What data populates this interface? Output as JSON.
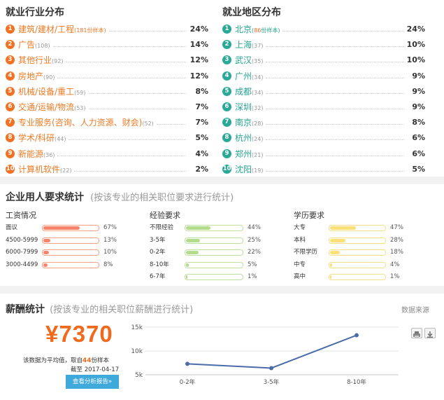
{
  "industry": {
    "title": "就业行业分布",
    "items": [
      {
        "rank": "1",
        "name": "建筑/建材/工程",
        "count_num": "181",
        "count_suffix": "份样本",
        "highlight": true,
        "pct": "24%"
      },
      {
        "rank": "2",
        "name": "广告",
        "count": "(108)",
        "pct": "14%"
      },
      {
        "rank": "3",
        "name": "其他行业",
        "count": "(92)",
        "pct": "12%"
      },
      {
        "rank": "4",
        "name": "房地产",
        "count": "(90)",
        "pct": "12%"
      },
      {
        "rank": "5",
        "name": "机械/设备/重工",
        "count": "(59)",
        "pct": "8%"
      },
      {
        "rank": "6",
        "name": "交通/运输/物流",
        "count": "(53)",
        "pct": "7%"
      },
      {
        "rank": "7",
        "name": "专业服务(咨询、人力资源、财会)",
        "count": "(52)",
        "pct": "7%"
      },
      {
        "rank": "8",
        "name": "学术/科研",
        "count": "(44)",
        "pct": "5%"
      },
      {
        "rank": "9",
        "name": "新能源",
        "count": "(36)",
        "pct": "4%"
      },
      {
        "rank": "10",
        "name": "计算机软件",
        "count": "(22)",
        "pct": "2%"
      }
    ]
  },
  "region": {
    "title": "就业地区分布",
    "items": [
      {
        "rank": "1",
        "name": "北京",
        "count_num": "86",
        "count_suffix": "份样本",
        "highlight": true,
        "pct": "24%"
      },
      {
        "rank": "2",
        "name": "上海",
        "count": "(37)",
        "pct": "10%"
      },
      {
        "rank": "3",
        "name": "武汉",
        "count": "(35)",
        "pct": "10%"
      },
      {
        "rank": "4",
        "name": "广州",
        "count": "(34)",
        "pct": "9%"
      },
      {
        "rank": "5",
        "name": "成都",
        "count": "(34)",
        "pct": "9%"
      },
      {
        "rank": "6",
        "name": "深圳",
        "count": "(32)",
        "pct": "9%"
      },
      {
        "rank": "7",
        "name": "南京",
        "count": "(28)",
        "pct": "8%"
      },
      {
        "rank": "8",
        "name": "杭州",
        "count": "(24)",
        "pct": "6%"
      },
      {
        "rank": "9",
        "name": "郑州",
        "count": "(21)",
        "pct": "6%"
      },
      {
        "rank": "10",
        "name": "沈阳",
        "count": "(19)",
        "pct": "5%"
      }
    ]
  },
  "requirements": {
    "title": "企业用人要求统计",
    "note": "(按该专业的相关职位要求进行统计)",
    "groups": [
      {
        "title": "工资情况",
        "track_color": "#f5a089",
        "fill_color": "#f7846a",
        "items": [
          {
            "label": "面议",
            "value": 67,
            "pct": "67%"
          },
          {
            "label": "4500-5999",
            "value": 13,
            "pct": "13%"
          },
          {
            "label": "6000-7999",
            "value": 10,
            "pct": "10%"
          },
          {
            "label": "3000-4499",
            "value": 8,
            "pct": "8%"
          }
        ]
      },
      {
        "title": "经验要求",
        "track_color": "#bfe0a0",
        "fill_color": "#b3dd8c",
        "items": [
          {
            "label": "不限经验",
            "value": 44,
            "pct": "44%"
          },
          {
            "label": "3-5年",
            "value": 25,
            "pct": "25%"
          },
          {
            "label": "0-2年",
            "value": 22,
            "pct": "22%"
          },
          {
            "label": "8-10年",
            "value": 5,
            "pct": "5%"
          },
          {
            "label": "6-7年",
            "value": 1,
            "pct": "1%"
          }
        ]
      },
      {
        "title": "学历要求",
        "track_color": "#f5e08a",
        "fill_color": "#fbe078",
        "items": [
          {
            "label": "大专",
            "value": 47,
            "pct": "47%"
          },
          {
            "label": "本科",
            "value": 28,
            "pct": "28%"
          },
          {
            "label": "不限学历",
            "value": 18,
            "pct": "18%"
          },
          {
            "label": "中专",
            "value": 4,
            "pct": "4%"
          },
          {
            "label": "高中",
            "value": 1,
            "pct": "1%"
          }
        ]
      }
    ]
  },
  "salary": {
    "title": "薪酬统计",
    "note": "(按该专业的相关职位薪酬进行统计)",
    "data_source": "数据来源",
    "amount": "¥7370",
    "desc_prefix": "该数据为平均值，取自",
    "desc_count": "44",
    "desc_suffix": "份样本",
    "date_line": "截至 2017-04-17",
    "report_button": "查看分析报告»"
  },
  "chart_data": {
    "type": "line",
    "categories": [
      "0-2年",
      "3-5年",
      "8-10年"
    ],
    "values": [
      7300,
      6400,
      13300
    ],
    "ylim": [
      5000,
      15000
    ],
    "yticks": [
      5000,
      10000,
      15000
    ],
    "ytick_labels": [
      "5k",
      "10k",
      "15k"
    ],
    "grid": true,
    "line_color": "#4a6ca8"
  },
  "colors": {
    "orange": "#f37122",
    "green": "#2aa898",
    "button_blue": "#3fa9dc",
    "salary_orange": "#f06a1e"
  }
}
